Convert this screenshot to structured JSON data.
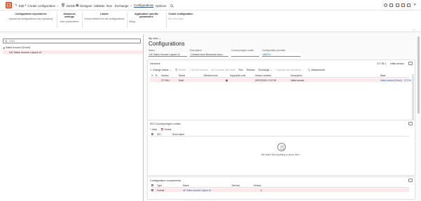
{
  "toolbar": {
    "edit": "Edit",
    "create_configuration": "Create configuration",
    "delete": "Delete",
    "designer": "Designer",
    "validate": "Validate",
    "run": "Run",
    "exchange": "Exchange",
    "configurations": "Configurations",
    "options": "Options",
    "home_icon": "app-launcher-icon",
    "accent": "#d83b01"
  },
  "ribbon": {
    "groups": [
      {
        "header": "Configuration repositories",
        "items": [
          "Upload all configurations into repository"
        ]
      },
      {
        "header": "Advanced settings",
        "items": [
          "User parameters"
        ]
      },
      {
        "header": "Labels",
        "items": [
          "Export labels from all configurations"
        ]
      },
      {
        "header": "Application specific parameters",
        "items": [
          "Setup"
        ]
      },
      {
        "header": "Create configuration",
        "items": [
          "Set new base"
        ]
      }
    ]
  },
  "tree": {
    "filter_placeholder": "Filter",
    "root": "Sales invoice (Excel)",
    "child": "UK Sales Invoice Layout v2"
  },
  "main": {
    "my_view": "My view",
    "title": "Configurations",
    "fields": {
      "name_label": "Name",
      "name_value": "UK Sales Invoice Layout v2",
      "description_label": "Description",
      "description_value": "Created from Business docu...",
      "country_label": "Country/region codes",
      "country_value": "",
      "provider_label": "Configuration provider",
      "provider_value": "eBBCS"
    },
    "versions": {
      "title": "Versions",
      "version_value": "277.55.1",
      "initial_version": "Initial version",
      "actions": {
        "change_status": "Change status",
        "delete": "Delete",
        "get_this_version": "Get this version",
        "compare_with_draft": "Compare with draft",
        "run": "Run",
        "rebase": "Rebase",
        "exchange": "Exchange",
        "upload_into_repository": "Upload into repository",
        "attachments": "Attachments"
      },
      "columns": [
        "R...",
        "Version",
        "Status",
        "Effective from",
        "Supported until",
        "Version created",
        "Description",
        "Base"
      ],
      "rows": [
        {
          "r": "",
          "version": "277.55.1",
          "status": "Draft",
          "effective_from": "",
          "supported_until": "",
          "version_created": "29/07/2025 17:07:03",
          "description": "Initial version",
          "base": "Sales invoice (Excel)",
          "base_version": "277.55"
        }
      ]
    },
    "iso": {
      "title": "ISO Country/region codes",
      "actions": {
        "new": "New",
        "delete": "Delete"
      },
      "columns": [
        "ISO",
        "Short name"
      ],
      "empty_message": "We didn't find anything to show here"
    },
    "components": {
      "title": "Configuration components",
      "columns": [
        "Type",
        "Name",
        "Derived",
        "Version"
      ],
      "rows": [
        {
          "type": "Format",
          "name": "UK Sales Invoice Layout v2",
          "derived": "",
          "version": "0"
        }
      ]
    }
  },
  "colors": {
    "selection": "#fde7e9",
    "link": "#0f6cbd",
    "accent": "#d83b01"
  }
}
